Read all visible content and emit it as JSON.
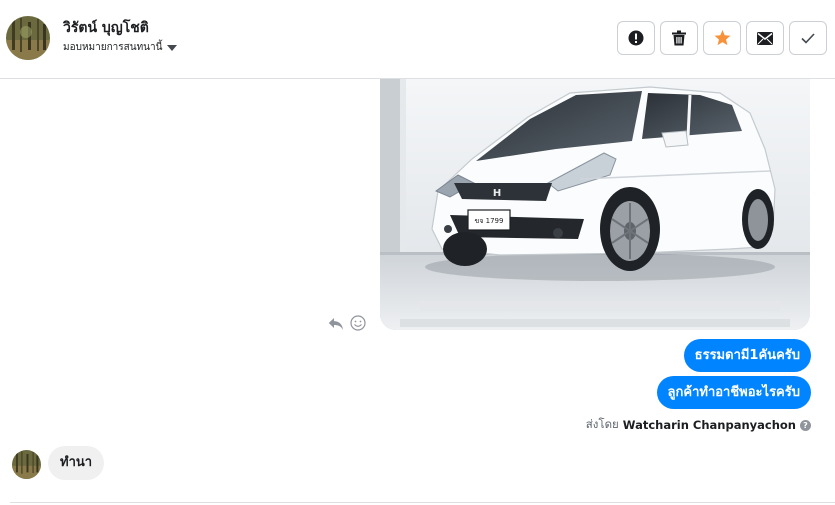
{
  "header": {
    "contact_name": "วิรัตน์ บุญโชติ",
    "assign_label": "มอบหมายการสนทนานี้",
    "actions": {
      "spam": "spam-icon",
      "delete": "trash-icon",
      "star": "star-icon",
      "unread": "envelope-icon",
      "done": "check-icon"
    }
  },
  "conversation": {
    "attachment": {
      "type": "image",
      "plate": "ขจ 1799"
    },
    "outgoing_messages": [
      "ธรรมดามี1คันครับ",
      "ลูกค้าทำอาชีพอะไรครับ"
    ],
    "sent_by_label": "ส่งโดย",
    "sent_by_name": "Watcharin Chanpanyachon",
    "incoming_messages": [
      "ทำนา"
    ]
  },
  "colors": {
    "accent": "#0084ff",
    "star": "#f7923a",
    "incoming_bubble": "#f0f0f0"
  }
}
